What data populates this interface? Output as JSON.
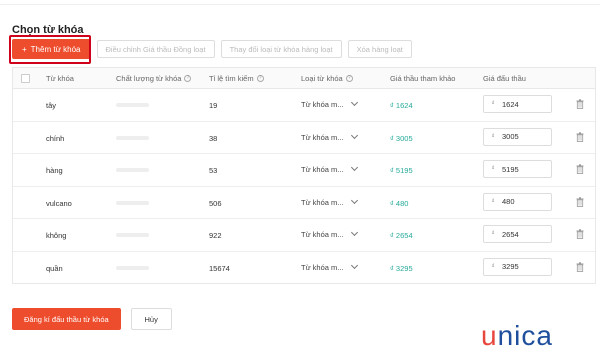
{
  "section": {
    "title": "Chọn từ khóa"
  },
  "actions": {
    "add_label": "Thêm từ khóa",
    "adjust_label": "Điều chỉnh Giá thầu Đồng loạt",
    "change_label": "Thay đổi loại từ khóa hàng loạt",
    "delete_label": "Xóa hàng loạt"
  },
  "table": {
    "headers": {
      "keyword": "Từ khóa",
      "quality": "Chất lượng từ khóa",
      "search_rate": "Tỉ lệ tìm kiếm",
      "type": "Loại từ khóa",
      "ref_price": "Giá thầu tham khảo",
      "bid": "Giá đấu thầu"
    },
    "rows": [
      {
        "keyword": "tây",
        "quality": 0.7,
        "search_rate": "19",
        "type": "Từ khóa m...",
        "ref_price": "₫ 1624",
        "currency": "₫",
        "bid": "1624"
      },
      {
        "keyword": "chính",
        "quality": 0.7,
        "search_rate": "38",
        "type": "Từ khóa m...",
        "ref_price": "₫ 3005",
        "currency": "₫",
        "bid": "3005"
      },
      {
        "keyword": "hàng",
        "quality": 0.7,
        "search_rate": "53",
        "type": "Từ khóa m...",
        "ref_price": "₫ 5195",
        "currency": "₫",
        "bid": "5195"
      },
      {
        "keyword": "vulcano",
        "quality": 0.7,
        "search_rate": "506",
        "type": "Từ khóa m...",
        "ref_price": "₫ 480",
        "currency": "₫",
        "bid": "480"
      },
      {
        "keyword": "không",
        "quality": 0.7,
        "search_rate": "922",
        "type": "Từ khóa m...",
        "ref_price": "₫ 2654",
        "currency": "₫",
        "bid": "2654"
      },
      {
        "keyword": "quần",
        "quality": 0.7,
        "search_rate": "15674",
        "type": "Từ khóa m...",
        "ref_price": "₫ 3295",
        "currency": "₫",
        "bid": "3295"
      }
    ]
  },
  "footer": {
    "submit_label": "Đăng kí đấu thầu từ khóa",
    "cancel_label": "Hủy"
  },
  "brand": {
    "logo_u": "u",
    "logo_rest": "nica"
  },
  "colors": {
    "accent": "#ee4d2d",
    "ref_price": "#26aa99",
    "highlight": "#d0021b"
  }
}
